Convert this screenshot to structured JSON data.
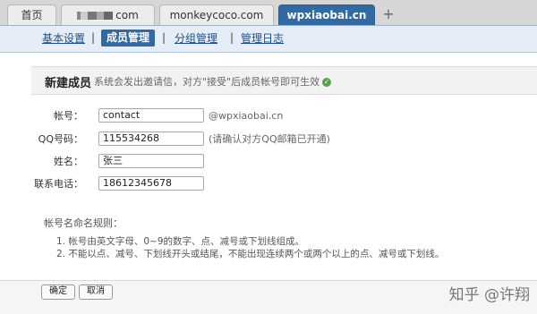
{
  "tabs": [
    {
      "label": "首页"
    },
    {
      "label": "com",
      "blurred": true
    },
    {
      "label": "monkeycoco.com"
    },
    {
      "label": "wpxiaobai.cn",
      "active": true
    }
  ],
  "tab_add": "+",
  "subnav": {
    "items": [
      "基本设置",
      "成员管理",
      "分组管理",
      "管理日志"
    ],
    "separator": "|"
  },
  "panel": {
    "title": "新建成员",
    "hint": "系统会发出邀请信，对方\"接受\"后成员帐号即可生效",
    "hint_icon": "check-icon"
  },
  "form": {
    "account_label": "帐号：",
    "account_value": "contact",
    "account_suffix": "@wpxiaobai.cn",
    "qq_label": "QQ号码：",
    "qq_value": "115534268",
    "qq_suffix": "(请确认对方QQ邮箱已开通)",
    "name_label": "姓名：",
    "name_value": "张三",
    "phone_label": "联系电话：",
    "phone_value": "18612345678"
  },
  "rules": {
    "title": "帐号名命名规则：",
    "items": [
      "1. 帐号由英文字母、0~9的数字、点、减号或下划线组成。",
      "2. 不能以点、减号、下划线开头或结尾，不能出现连续两个或两个以上的点、减号或下划线。"
    ]
  },
  "buttons": {
    "confirm": "确定",
    "cancel": "取消"
  },
  "watermark": "知乎 @许翔",
  "colors": {
    "accent": "#2f6aa6",
    "nav_bg": "#e5edf6"
  }
}
